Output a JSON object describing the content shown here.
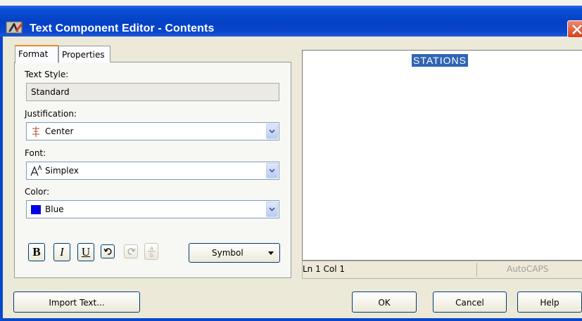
{
  "window": {
    "title": "Text Component Editor - Contents",
    "app_icon": "autocad-icon",
    "close_icon": "close-icon"
  },
  "tabs": [
    {
      "label": "Format",
      "active": true
    },
    {
      "label": "Properties",
      "active": false
    }
  ],
  "format": {
    "text_style_label": "Text Style:",
    "text_style_value": "Standard",
    "justification_label": "Justification:",
    "justification_value": "Center",
    "font_label": "Font:",
    "font_value": "Simplex",
    "color_label": "Color:",
    "color_value": "Blue",
    "color_swatch": "#0000e6",
    "bold_label": "B",
    "italic_label": "I",
    "underline_label": "U",
    "symbol_label": "Symbol"
  },
  "preview": {
    "text": "STATIONS",
    "highlight_color": "#3065b3"
  },
  "status": {
    "position": "Ln 1 Col 1",
    "autocaps": "AutoCAPS"
  },
  "buttons": {
    "import_text": "Import Text...",
    "ok": "OK",
    "cancel": "Cancel",
    "help": "Help"
  }
}
